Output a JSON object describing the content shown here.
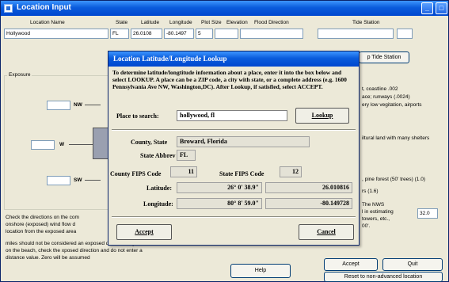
{
  "window": {
    "title": "Location Input",
    "min_glyph": "_",
    "max_glyph": "□"
  },
  "headers": {
    "location_name": "Location Name",
    "state": "State",
    "latitude": "Latitude",
    "longitude": "Longitude",
    "plot_size": "Plot Size",
    "elevation": "Elevation",
    "flood_direction": "Flood Direction",
    "tide_station": "Tide Station"
  },
  "inputs": {
    "location_name": "Hollywood",
    "state": "FL",
    "latitude": "26.0108",
    "longitude": "-80.1497",
    "plot_size": "5",
    "elevation": "",
    "flood_direction": "",
    "tide_station": ""
  },
  "tide_button": "p Tide Station",
  "exposure": {
    "title": "Exposure",
    "directions": [
      "NW",
      "W",
      "SW"
    ]
  },
  "right_panel": {
    "line1": "t, coastline .002",
    "line2": "ace; runways (.0024)",
    "line3": "ery low vegitation, airports",
    "line4": "iltural land with many shelters",
    "line5": ", pine forest (50' trees) (1.0)",
    "line6": "rs (1.6)",
    "line7": "  The NWS",
    "line8": "l in estimating",
    "line9": " towers, etc.,",
    "line10": "00'.",
    "value": "32.0"
  },
  "help_text": {
    "line1": "Check the directions on the com",
    "line2": "onshore (exposed) wind flow d",
    "line3": "location from the exposed area",
    "line4": "miles should not be considered an exposed direction.  If you are",
    "line5": "on the beach, check the xposed direction and do not enter a",
    "line6": "distance value.  Zero will be assumed"
  },
  "bottom_buttons": {
    "help": "Help",
    "accept": "Accept",
    "quit": "Quit",
    "reset": "Reset to non-advanced location"
  },
  "dialog": {
    "title": "Location Latitude/Longitude Lookup",
    "instructions": "To determine latitude/longtitude information about a place, enter it into the box below and select LOOKUP.  A place can be a ZIP code, a city with state, or a complete address (e.g. 1600 Pennsylvania Ave NW, Washington,DC).  After Lookup, if satisfied, select ACCEPT.",
    "place_label": "Place to search:",
    "place_value": "hollywood, fl",
    "lookup_button": "Lookup",
    "county_state_label": "County, State",
    "county_state_value": "Broward, Florida",
    "state_abbrev_label": "State Abbrev",
    "state_abbrev_value": "FL",
    "county_fips_label": "County FIPS Code",
    "county_fips_value": "11",
    "state_fips_label": "State FIPS Code",
    "state_fips_value": "12",
    "latitude_label": "Latitude:",
    "latitude_dms": "26° 0' 38.9\"",
    "latitude_dec": "26.010816",
    "longitude_label": "Longitude:",
    "longitude_dms": "80° 8' 59.0\"",
    "longitude_dec": "-80.149728",
    "accept_button": "Accept",
    "cancel_button": "Cancel"
  }
}
